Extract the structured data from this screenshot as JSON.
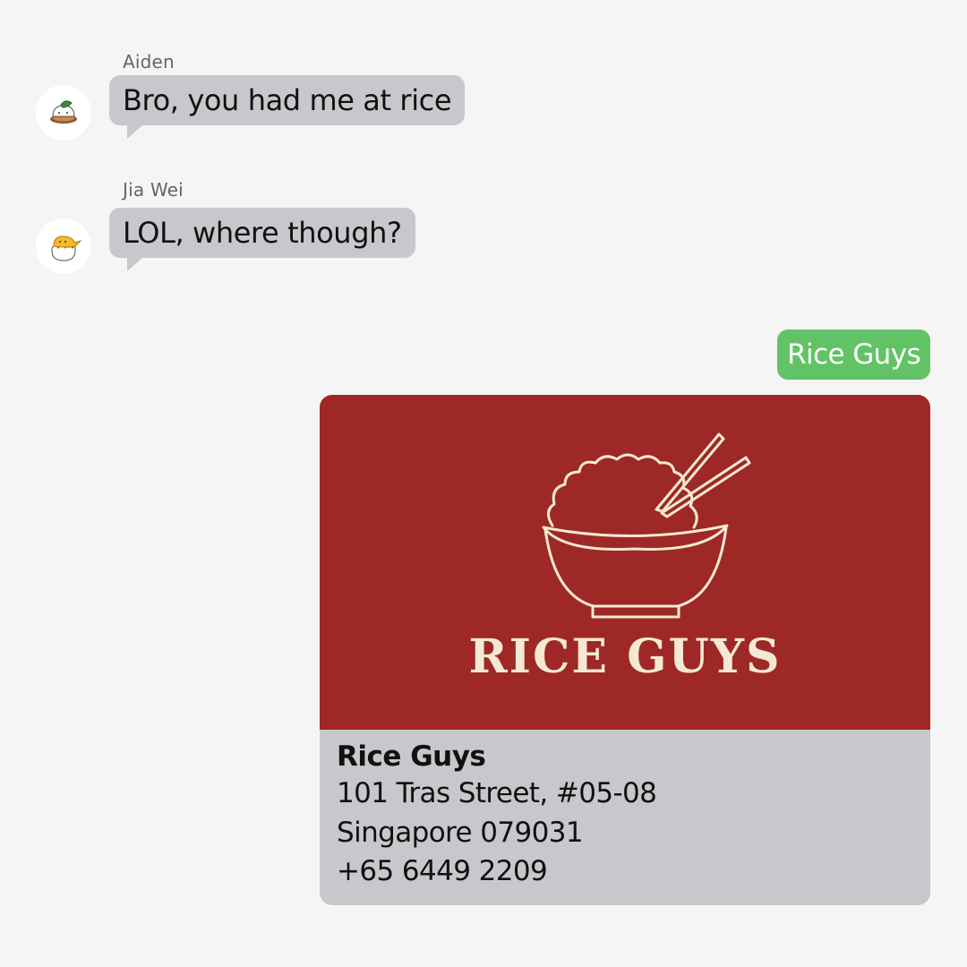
{
  "messages": [
    {
      "sender": "Aiden",
      "text": "Bro, you had me at rice",
      "avatar_icon": "rice-bowl-character-icon"
    },
    {
      "sender": "Jia Wei",
      "text": "LOL, where though?",
      "avatar_icon": "egg-character-icon"
    }
  ],
  "outgoing": {
    "text": "Rice Guys"
  },
  "location_card": {
    "banner_text": "RICE GUYS",
    "banner_icon": "rice-bowl-chopsticks-icon",
    "name": "Rice Guys",
    "address_line1": "101 Tras Street, #05-08",
    "address_line2": "Singapore 079031",
    "phone": "+65 6449 2209"
  },
  "colors": {
    "background": "#f5f5f5",
    "incoming_bubble": "#c8c8cc",
    "outgoing_bubble": "#62c366",
    "card_banner": "#9e2826",
    "card_banner_text": "#f5e9d2"
  }
}
